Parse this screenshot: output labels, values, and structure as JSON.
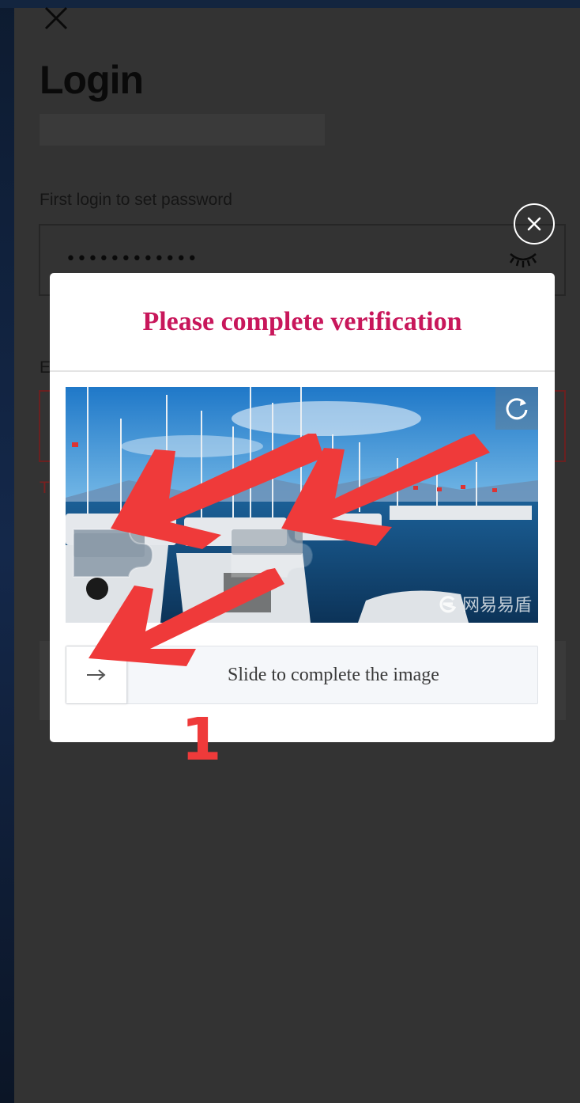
{
  "login": {
    "title": "Login",
    "password_label": "First login to set password",
    "password_value": "••••••••••••",
    "email_label_partial": "E",
    "error_partial": "T"
  },
  "captcha": {
    "title": "Please complete verification",
    "slider_text": "Slide to complete the image",
    "watermark_text": "网易易盾",
    "title_color": "#c8175b"
  },
  "annotation": {
    "step_number": "1",
    "color": "#ef3a3a"
  },
  "icons": {
    "close": "close-icon",
    "modal_close": "circle-close-icon",
    "eye": "eye-closed-icon",
    "refresh": "refresh-icon",
    "slider": "arrow-right-icon"
  }
}
